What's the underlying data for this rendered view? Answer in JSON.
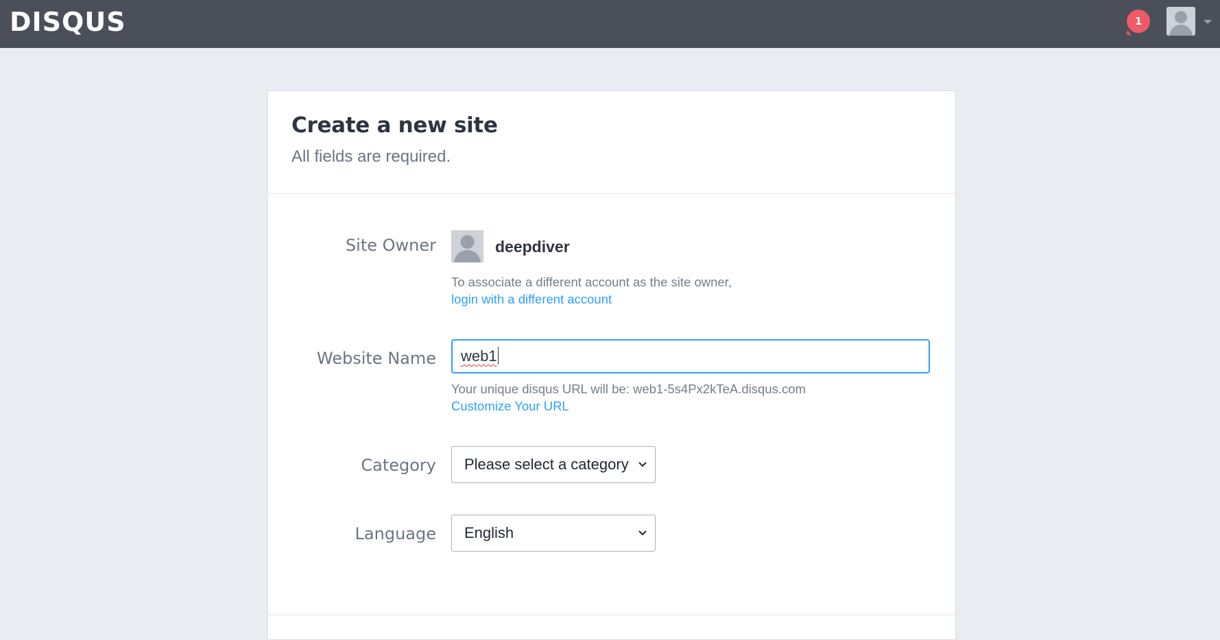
{
  "header": {
    "logo": "DISQUS",
    "notification_count": "1"
  },
  "form": {
    "title": "Create a new site",
    "subtitle": "All fields are required.",
    "site_owner": {
      "label": "Site Owner",
      "username": "deepdiver",
      "help_text": "To associate a different account as the site owner,",
      "link": "login with a different account"
    },
    "website_name": {
      "label": "Website Name",
      "value": "web1",
      "help_prefix": "Your unique disqus URL will be: ",
      "url": "web1-5s4Px2kTeA.disqus.com",
      "link": "Customize Your URL"
    },
    "category": {
      "label": "Category",
      "selected": "Please select a category"
    },
    "language": {
      "label": "Language",
      "selected": "English"
    }
  },
  "colors": {
    "topbar": "#4a4f5a",
    "page_bg": "#e9edf2",
    "link": "#2e9fff",
    "badge": "#f05a67",
    "input_focus": "#2e9fff"
  },
  "icons": {
    "notification": "speech-bubble-badge-icon",
    "user": "user-avatar-icon",
    "caret": "caret-down-icon",
    "select_chevron": "chevron-down-icon"
  }
}
